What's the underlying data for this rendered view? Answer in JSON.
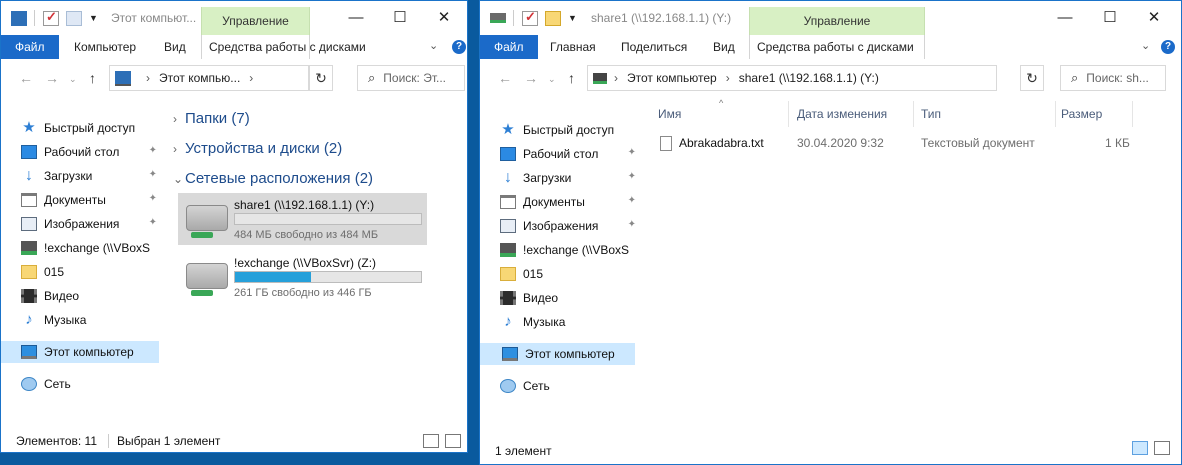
{
  "left_window": {
    "title": "Этот компьют...",
    "context_tab_header": "Управление",
    "ribbon": {
      "file": "Файл",
      "tabs": [
        "Компьютер",
        "Вид"
      ],
      "context_tab": "Средства работы с дисками"
    },
    "address": {
      "segments": [
        "Этот компью..."
      ]
    },
    "search_placeholder": "Поиск: Эт...",
    "nav": [
      {
        "label": "Быстрый доступ",
        "icon": "star-icon"
      },
      {
        "label": "Рабочий стол",
        "icon": "desktop-icon",
        "pinned": true
      },
      {
        "label": "Загрузки",
        "icon": "download-icon",
        "pinned": true
      },
      {
        "label": "Документы",
        "icon": "documents-icon",
        "pinned": true
      },
      {
        "label": "Изображения",
        "icon": "pictures-icon",
        "pinned": true
      },
      {
        "label": "!exchange (\\\\VBoxS",
        "icon": "network-drive-icon"
      },
      {
        "label": "015",
        "icon": "folder-icon"
      },
      {
        "label": "Видео",
        "icon": "video-icon"
      },
      {
        "label": "Музыка",
        "icon": "music-icon"
      },
      {
        "label": "Этот компьютер",
        "icon": "computer-icon",
        "selected": true
      },
      {
        "label": "Сеть",
        "icon": "network-icon"
      }
    ],
    "groups": [
      {
        "label": "Папки (7)",
        "expanded": false
      },
      {
        "label": "Устройства и диски (2)",
        "expanded": false
      },
      {
        "label": "Сетевые расположения (2)",
        "expanded": true
      }
    ],
    "drives": [
      {
        "name": "share1 (\\\\192.168.1.1) (Y:)",
        "free": "484 МБ свободно из 484 МБ",
        "used_fraction": 0.0,
        "selected": true
      },
      {
        "name": "!exchange (\\\\VBoxSvr) (Z:)",
        "free": "261 ГБ свободно из 446 ГБ",
        "used_fraction": 0.41,
        "selected": false
      }
    ],
    "status": {
      "items": "Элементов: 11",
      "selected": "Выбран 1 элемент"
    }
  },
  "right_window": {
    "title": "share1 (\\\\192.168.1.1) (Y:)",
    "context_tab_header": "Управление",
    "ribbon": {
      "file": "Файл",
      "tabs": [
        "Главная",
        "Поделиться",
        "Вид"
      ],
      "context_tab": "Средства работы с дисками"
    },
    "address": {
      "segments": [
        "Этот компьютер",
        "share1 (\\\\192.168.1.1) (Y:)"
      ]
    },
    "search_placeholder": "Поиск: sh...",
    "nav": [
      {
        "label": "Быстрый доступ",
        "icon": "star-icon"
      },
      {
        "label": "Рабочий стол",
        "icon": "desktop-icon",
        "pinned": true
      },
      {
        "label": "Загрузки",
        "icon": "download-icon",
        "pinned": true
      },
      {
        "label": "Документы",
        "icon": "documents-icon",
        "pinned": true
      },
      {
        "label": "Изображения",
        "icon": "pictures-icon",
        "pinned": true
      },
      {
        "label": "!exchange (\\\\VBoxS",
        "icon": "network-drive-icon"
      },
      {
        "label": "015",
        "icon": "folder-icon"
      },
      {
        "label": "Видео",
        "icon": "video-icon"
      },
      {
        "label": "Музыка",
        "icon": "music-icon"
      },
      {
        "label": "Этот компьютер",
        "icon": "computer-icon",
        "selected": true
      },
      {
        "label": "Сеть",
        "icon": "network-icon"
      }
    ],
    "columns": [
      "Имя",
      "Дата изменения",
      "Тип",
      "Размер"
    ],
    "files": [
      {
        "name": "Abrakadabra.txt",
        "modified": "30.04.2020 9:32",
        "type": "Текстовый документ",
        "size": "1 КБ"
      }
    ],
    "status": {
      "items": "1 элемент"
    }
  },
  "colors": {
    "accent": "#1b6ac9",
    "context_tab": "#d8f0c4",
    "selection": "#cce8ff",
    "drive_bar": "#26a0da"
  }
}
